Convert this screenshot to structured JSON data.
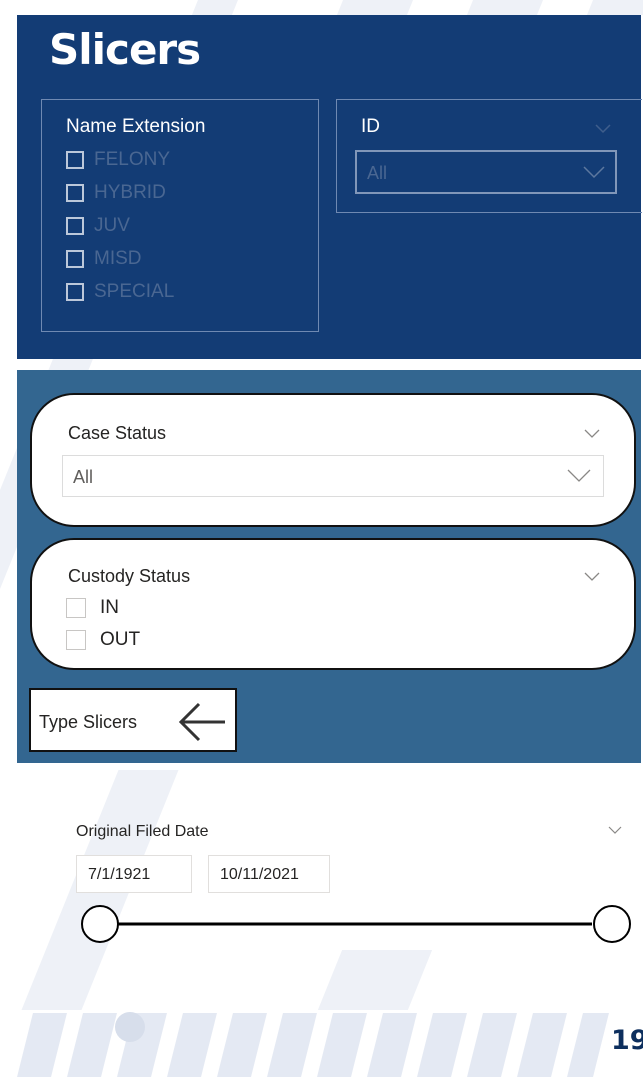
{
  "title": "Slicers",
  "name_extension": {
    "title": "Name Extension",
    "options": [
      "FELONY",
      "HYBRID",
      "JUV",
      "MISD",
      "SPECIAL"
    ]
  },
  "id_slicer": {
    "title": "ID",
    "value": "All"
  },
  "case_status": {
    "title": "Case Status",
    "value": "All"
  },
  "custody_status": {
    "title": "Custody Status",
    "options": [
      "IN",
      "OUT"
    ]
  },
  "type_slicers_label": "Type Slicers",
  "date_slicer": {
    "title": "Original Filed Date",
    "start": "7/1/1921",
    "end": "10/11/2021"
  },
  "page_number": "19",
  "colors": {
    "dark_panel": "#133c75",
    "mid_panel": "#336690",
    "page_number": "#0d2f5e"
  }
}
